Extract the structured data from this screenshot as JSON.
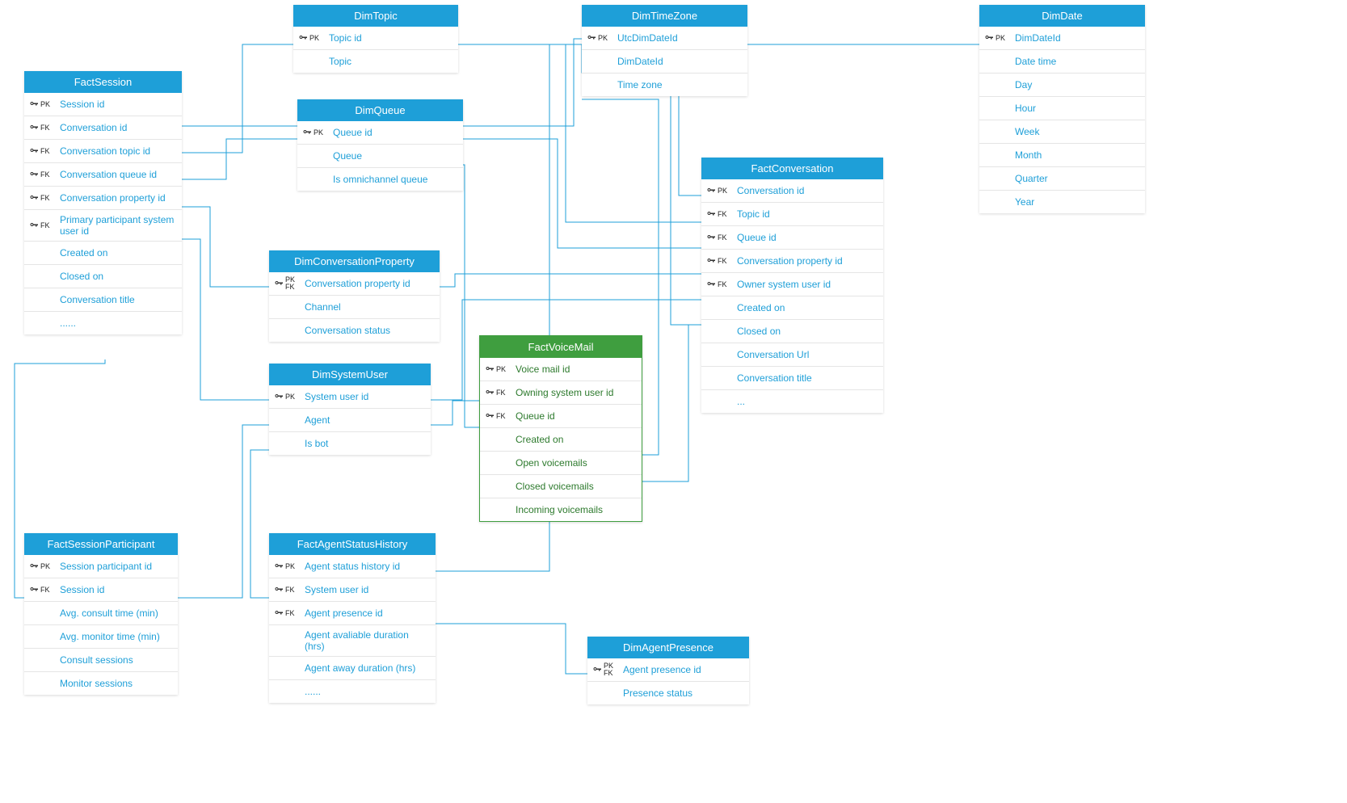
{
  "entities": {
    "FactSession": {
      "title": "FactSession",
      "rows": [
        {
          "key": "PK",
          "name": "Session id"
        },
        {
          "key": "FK",
          "name": "Conversation id"
        },
        {
          "key": "FK",
          "name": "Conversation topic id"
        },
        {
          "key": "FK",
          "name": "Conversation queue id"
        },
        {
          "key": "FK",
          "name": "Conversation property id"
        },
        {
          "key": "FK",
          "name": "Primary participant system user id"
        },
        {
          "key": "",
          "name": "Created on"
        },
        {
          "key": "",
          "name": "Closed on"
        },
        {
          "key": "",
          "name": "Conversation title"
        },
        {
          "key": "",
          "name": "......"
        }
      ]
    },
    "DimTopic": {
      "title": "DimTopic",
      "rows": [
        {
          "key": "PK",
          "name": "Topic id"
        },
        {
          "key": "",
          "name": "Topic"
        }
      ]
    },
    "DimQueue": {
      "title": "DimQueue",
      "rows": [
        {
          "key": "PK",
          "name": "Queue id"
        },
        {
          "key": "",
          "name": "Queue"
        },
        {
          "key": "",
          "name": "Is omnichannel queue"
        }
      ]
    },
    "DimConversationProperty": {
      "title": "DimConversationProperty",
      "rows": [
        {
          "key": "PKFK",
          "name": "Conversation property id"
        },
        {
          "key": "",
          "name": "Channel"
        },
        {
          "key": "",
          "name": "Conversation status"
        }
      ]
    },
    "DimSystemUser": {
      "title": "DimSystemUser",
      "rows": [
        {
          "key": "PK",
          "name": "System user id"
        },
        {
          "key": "",
          "name": "Agent"
        },
        {
          "key": "",
          "name": "Is bot"
        }
      ]
    },
    "DimTimeZone": {
      "title": "DimTimeZone",
      "rows": [
        {
          "key": "PK",
          "name": "UtcDimDateId"
        },
        {
          "key": "",
          "name": "DimDateId"
        },
        {
          "key": "",
          "name": "Time zone"
        }
      ]
    },
    "DimDate": {
      "title": "DimDate",
      "rows": [
        {
          "key": "PK",
          "name": "DimDateId"
        },
        {
          "key": "",
          "name": "Date time"
        },
        {
          "key": "",
          "name": "Day"
        },
        {
          "key": "",
          "name": "Hour"
        },
        {
          "key": "",
          "name": "Week"
        },
        {
          "key": "",
          "name": "Month"
        },
        {
          "key": "",
          "name": "Quarter"
        },
        {
          "key": "",
          "name": "Year"
        }
      ]
    },
    "FactConversation": {
      "title": "FactConversation",
      "rows": [
        {
          "key": "PK",
          "name": "Conversation id"
        },
        {
          "key": "FK",
          "name": "Topic id"
        },
        {
          "key": "FK",
          "name": "Queue id"
        },
        {
          "key": "FK",
          "name": "Conversation property id"
        },
        {
          "key": "FK",
          "name": "Owner system user id"
        },
        {
          "key": "",
          "name": "Created on"
        },
        {
          "key": "",
          "name": "Closed on"
        },
        {
          "key": "",
          "name": "Conversation Url"
        },
        {
          "key": "",
          "name": "Conversation title"
        },
        {
          "key": "",
          "name": "..."
        }
      ]
    },
    "FactVoiceMail": {
      "title": "FactVoiceMail",
      "rows": [
        {
          "key": "PK",
          "name": "Voice mail id"
        },
        {
          "key": "FK",
          "name": "Owning system user id"
        },
        {
          "key": "FK",
          "name": "Queue id"
        },
        {
          "key": "",
          "name": "Created on"
        },
        {
          "key": "",
          "name": "Open voicemails"
        },
        {
          "key": "",
          "name": "Closed voicemails"
        },
        {
          "key": "",
          "name": "Incoming voicemails"
        }
      ]
    },
    "FactSessionParticipant": {
      "title": "FactSessionParticipant",
      "rows": [
        {
          "key": "PK",
          "name": "Session participant id"
        },
        {
          "key": "FK",
          "name": "Session id"
        },
        {
          "key": "",
          "name": "Avg. consult time (min)"
        },
        {
          "key": "",
          "name": "Avg. monitor time (min)"
        },
        {
          "key": "",
          "name": "Consult sessions"
        },
        {
          "key": "",
          "name": "Monitor sessions"
        }
      ]
    },
    "FactAgentStatusHistory": {
      "title": "FactAgentStatusHistory",
      "rows": [
        {
          "key": "PK",
          "name": "Agent status history id"
        },
        {
          "key": "FK",
          "name": "System user id"
        },
        {
          "key": "FK",
          "name": "Agent presence id"
        },
        {
          "key": "",
          "name": "Agent avaliable duration (hrs)"
        },
        {
          "key": "",
          "name": "Agent away duration (hrs)"
        },
        {
          "key": "",
          "name": "......"
        }
      ]
    },
    "DimAgentPresence": {
      "title": "DimAgentPresence",
      "rows": [
        {
          "key": "PKFK",
          "name": "Agent presence id"
        },
        {
          "key": "",
          "name": "Presence status"
        }
      ]
    }
  }
}
